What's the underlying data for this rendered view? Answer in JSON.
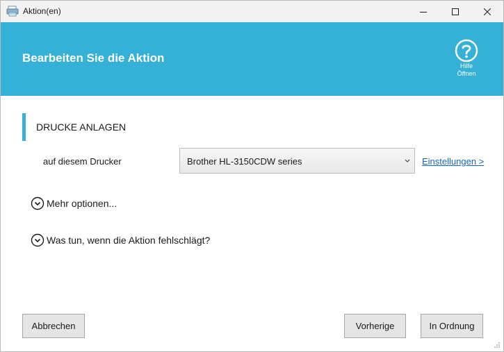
{
  "window": {
    "title": "Aktion(en)"
  },
  "header": {
    "title": "Bearbeiten Sie die Aktion",
    "help_line1": "Hilfe",
    "help_line2": "Öffnen"
  },
  "section": {
    "title": "DRUCKE ANLAGEN"
  },
  "printer": {
    "label": "auf diesem Drucker",
    "selected": "Brother HL-3150CDW series",
    "settings_link": "Einstellungen >"
  },
  "expanders": {
    "more_options": "Mehr optionen...",
    "on_failure": "Was tun, wenn die Aktion fehlschlägt?"
  },
  "buttons": {
    "cancel": "Abbrechen",
    "previous": "Vorherige",
    "ok": "In Ordnung"
  },
  "colors": {
    "accent": "#35b0d6",
    "link": "#1565c0",
    "button_bg": "#e5e5e5"
  },
  "icons": {
    "app": "printer-app-icon",
    "help": "question-circle-icon",
    "expand": "chevron-down-circle-icon"
  }
}
